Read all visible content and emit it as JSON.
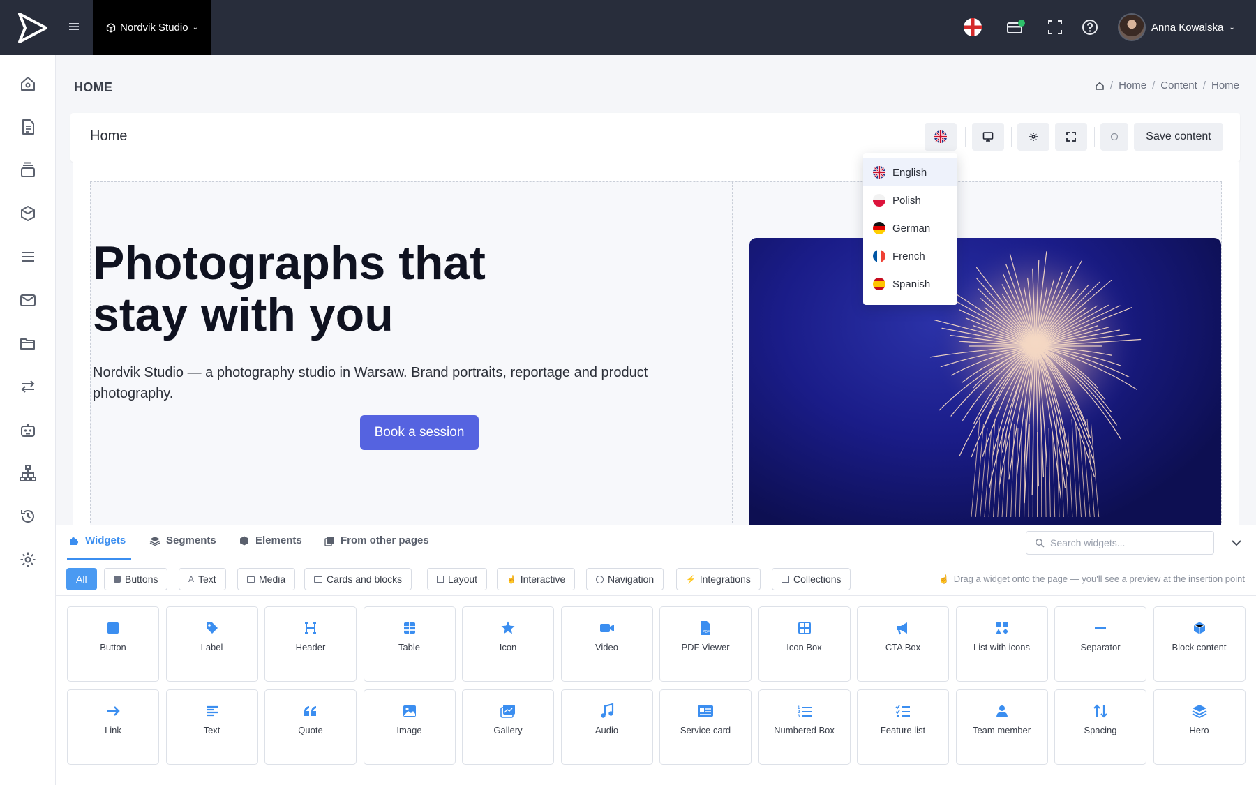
{
  "topbar": {
    "studio_name": "Nordvik Studio",
    "user_name": "Anna Kowalska"
  },
  "page": {
    "title": "HOME",
    "breadcrumb": [
      "Home",
      "Content",
      "Home"
    ]
  },
  "editor": {
    "title": "Home",
    "save_label": "Save content"
  },
  "hero": {
    "title_line1": "Photographs that",
    "title_line2": "stay with you",
    "description": "Nordvik Studio — a photography studio in Warsaw. Brand portraits, reportage and product photography.",
    "cta_label": "Book a session"
  },
  "languages": [
    {
      "label": "English",
      "flag": "uk",
      "active": true
    },
    {
      "label": "Polish",
      "flag": "pl"
    },
    {
      "label": "German",
      "flag": "de"
    },
    {
      "label": "French",
      "flag": "fr"
    },
    {
      "label": "Spanish",
      "flag": "es"
    }
  ],
  "panel": {
    "tabs": [
      "Widgets",
      "Segments",
      "Elements",
      "From other pages"
    ],
    "search_placeholder": "Search widgets...",
    "filters": [
      "All",
      "Buttons",
      "Text",
      "Media",
      "Cards and blocks",
      "Layout",
      "Interactive",
      "Navigation",
      "Integrations",
      "Collections"
    ],
    "drag_hint": "Drag a widget onto the page — you'll see a preview at the insertion point",
    "widgets_row1": [
      {
        "label": "Button",
        "icon": "square-icon"
      },
      {
        "label": "Label",
        "icon": "tag-icon"
      },
      {
        "label": "Header",
        "icon": "heading-icon"
      },
      {
        "label": "Table",
        "icon": "table-icon"
      },
      {
        "label": "Icon",
        "icon": "star-icon"
      },
      {
        "label": "Video",
        "icon": "video-icon"
      },
      {
        "label": "PDF Viewer",
        "icon": "pdf-icon"
      },
      {
        "label": "Icon Box",
        "icon": "grid-box-icon"
      },
      {
        "label": "CTA Box",
        "icon": "megaphone-icon"
      },
      {
        "label": "List with icons",
        "icon": "icons-list-icon"
      },
      {
        "label": "Separator",
        "icon": "minus-icon"
      },
      {
        "label": "Block content",
        "icon": "cube-icon"
      }
    ],
    "widgets_row2": [
      {
        "label": "Link",
        "icon": "arrow-right-icon"
      },
      {
        "label": "Text",
        "icon": "text-lines-icon"
      },
      {
        "label": "Quote",
        "icon": "quote-icon"
      },
      {
        "label": "Image",
        "icon": "image-icon"
      },
      {
        "label": "Gallery",
        "icon": "gallery-icon"
      },
      {
        "label": "Audio",
        "icon": "music-icon"
      },
      {
        "label": "Service card",
        "icon": "card-icon"
      },
      {
        "label": "Numbered Box",
        "icon": "numbered-list-icon"
      },
      {
        "label": "Feature list",
        "icon": "checklist-icon"
      },
      {
        "label": "Team member",
        "icon": "user-icon"
      },
      {
        "label": "Spacing",
        "icon": "up-down-arrows-icon"
      },
      {
        "label": "Hero",
        "icon": "layers-icon"
      }
    ]
  },
  "colors": {
    "topbar": "#282d3b",
    "accent": "#3b8ef0",
    "cta": "#5563e0"
  }
}
